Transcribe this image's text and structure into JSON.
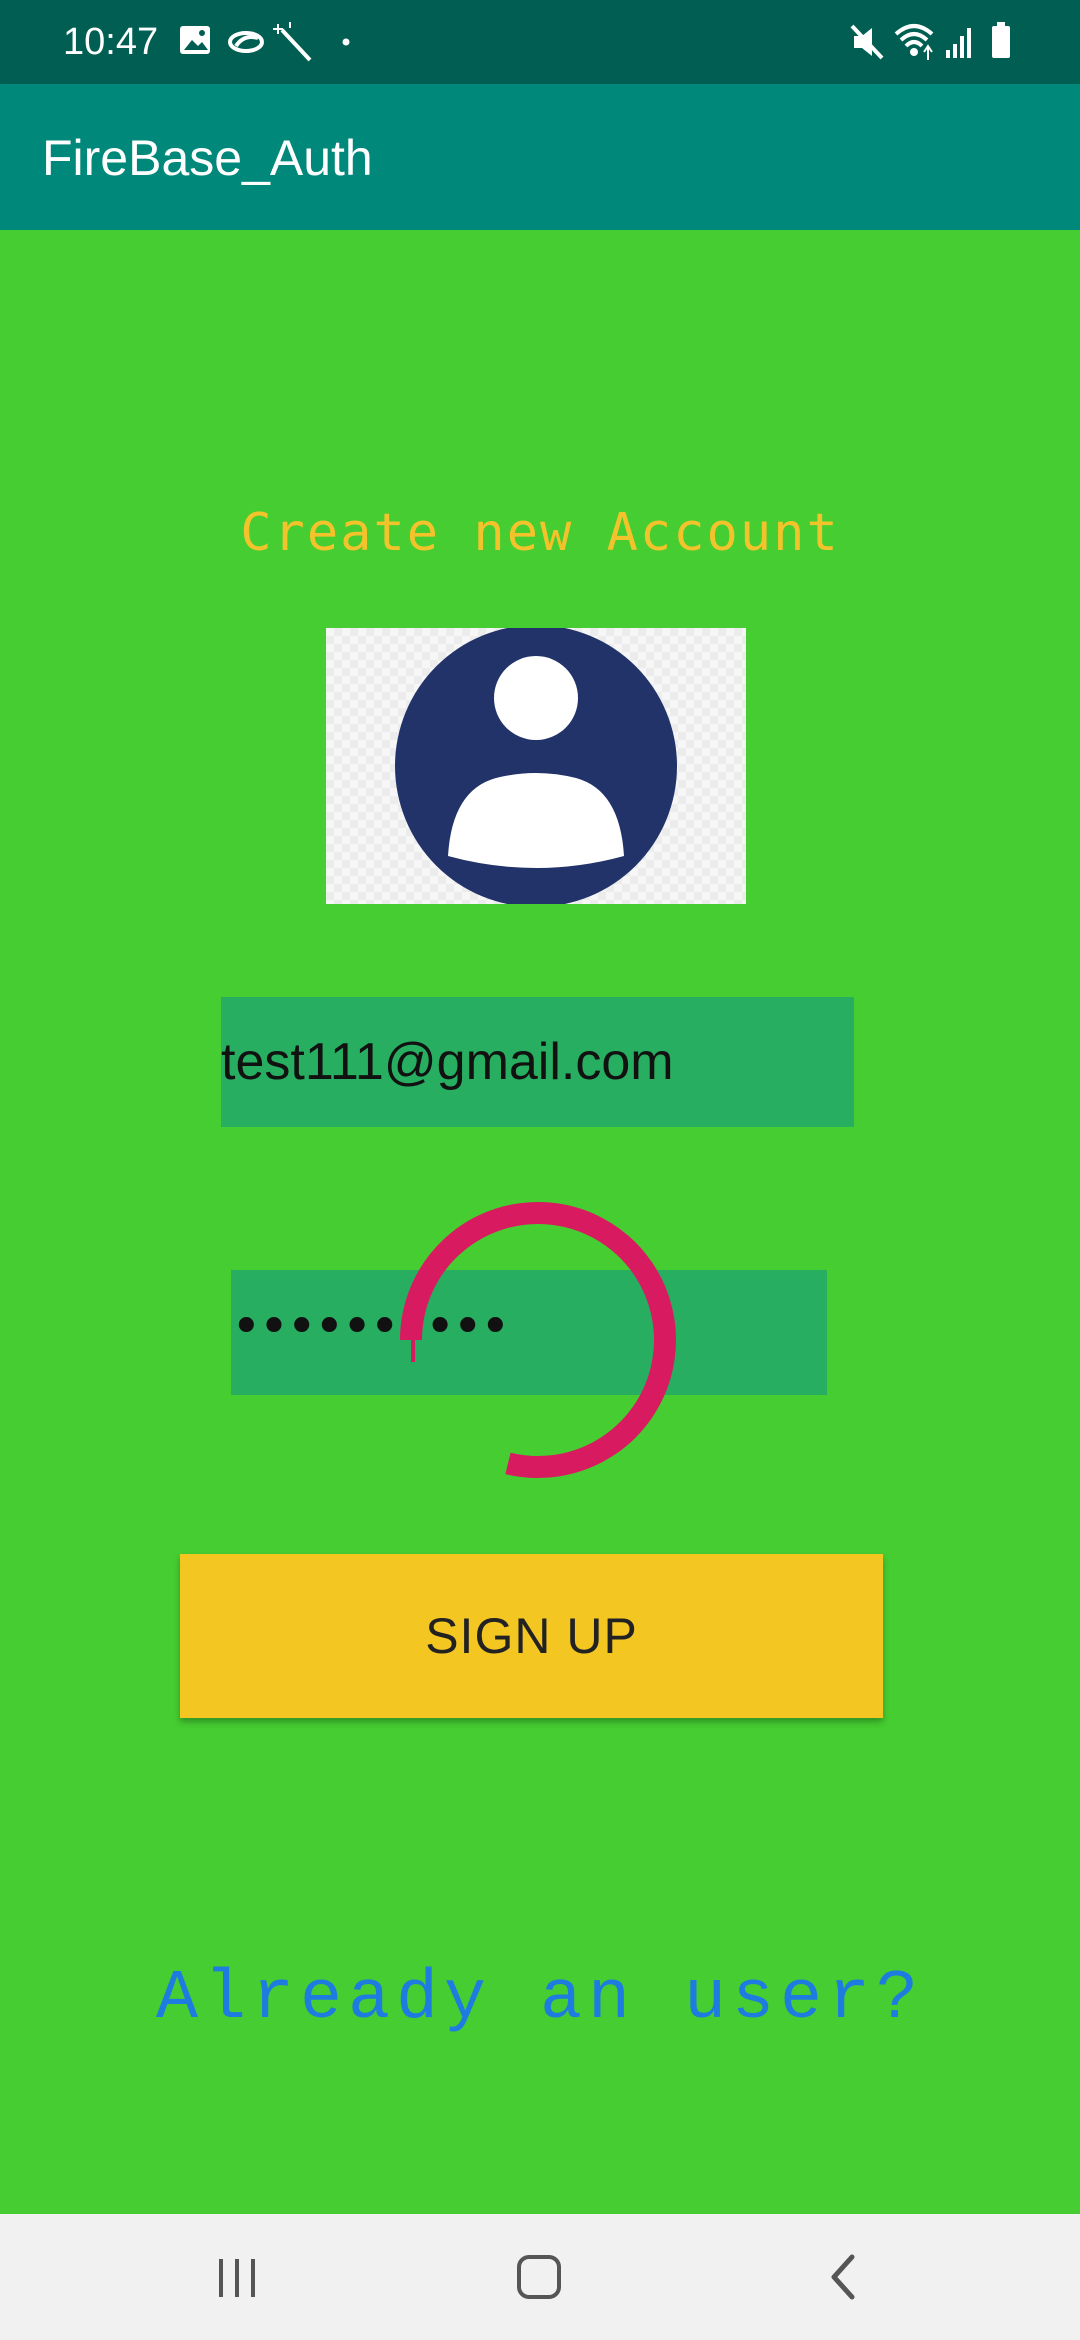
{
  "status_bar": {
    "time": "10:47",
    "left_icons": [
      "image-icon",
      "swirl-icon",
      "magic-wand-icon",
      "dot-icon"
    ],
    "right_icons": [
      "mute-icon",
      "wifi-icon",
      "signal-icon",
      "battery-icon"
    ]
  },
  "app_bar": {
    "title": "FireBase_Auth"
  },
  "form": {
    "heading": "Create new Account",
    "avatar_icon": "user-placeholder-icon",
    "email_value": "test111@gmail.com",
    "password_value": "••••••••••",
    "signup_label": "SIGN UP",
    "already_user_label": "Already an user?"
  },
  "nav_bar": {
    "icons": [
      "recent-apps-icon",
      "home-icon",
      "back-icon"
    ]
  },
  "colors": {
    "status_bar": "#005f52",
    "app_bar": "#00897b",
    "background": "#45cd31",
    "heading": "#f2c32a",
    "input_fill": "#27ae60",
    "button": "#f4c622",
    "spinner": "#d81b60",
    "link": "#1e7be0"
  }
}
